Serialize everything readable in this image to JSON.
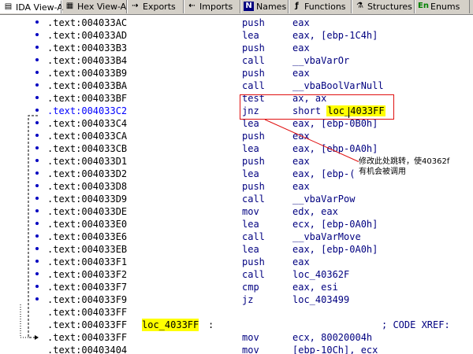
{
  "tabs": [
    {
      "label": "IDA View-A",
      "icon": "ida-view-icon",
      "glyph": "▤",
      "active": true
    },
    {
      "label": "Hex View-A",
      "icon": "hex-view-icon",
      "glyph": "▦",
      "active": false
    },
    {
      "label": "Exports",
      "icon": "exports-icon",
      "glyph": "⇢",
      "active": false
    },
    {
      "label": "Imports",
      "icon": "imports-icon",
      "glyph": "⇠",
      "active": false
    },
    {
      "label": "Names",
      "icon": "names-icon",
      "glyph": "N",
      "active": false
    },
    {
      "label": "Functions",
      "icon": "functions-icon",
      "glyph": "ƒ",
      "active": false
    },
    {
      "label": "Structures",
      "icon": "structures-icon",
      "glyph": "⚗",
      "active": false
    },
    {
      "label": "Enums",
      "icon": "enums-icon",
      "glyph": "En",
      "active": false
    }
  ],
  "rows": [
    {
      "addr": ".text:004033AC",
      "mnem": "push",
      "ops": "eax"
    },
    {
      "addr": ".text:004033AD",
      "mnem": "lea",
      "ops": "eax, [ebp-1C4h]"
    },
    {
      "addr": ".text:004033B3",
      "mnem": "push",
      "ops": "eax"
    },
    {
      "addr": ".text:004033B4",
      "mnem": "call",
      "ops": "__vbaVarOr"
    },
    {
      "addr": ".text:004033B9",
      "mnem": "push",
      "ops": "eax"
    },
    {
      "addr": ".text:004033BA",
      "mnem": "call",
      "ops": "__vbaBoolVarNull"
    },
    {
      "addr": ".text:004033BF",
      "mnem": "test",
      "ops": "ax, ax"
    },
    {
      "addr": ".text:004033C2",
      "mnem": "jnz",
      "ops_prefix": "short ",
      "ops_hl": "loc_4033FF",
      "addr_hl": true
    },
    {
      "addr": ".text:004033C4",
      "mnem": "lea",
      "ops": "eax, [ebp-0B0h]"
    },
    {
      "addr": ".text:004033CA",
      "mnem": "push",
      "ops": "eax"
    },
    {
      "addr": ".text:004033CB",
      "mnem": "lea",
      "ops": "eax, [ebp-0A0h]"
    },
    {
      "addr": ".text:004033D1",
      "mnem": "push",
      "ops": "eax"
    },
    {
      "addr": ".text:004033D2",
      "mnem": "lea",
      "ops": "eax, [ebp-("
    },
    {
      "addr": ".text:004033D8",
      "mnem": "push",
      "ops": "eax"
    },
    {
      "addr": ".text:004033D9",
      "mnem": "call",
      "ops": "__vbaVarPow"
    },
    {
      "addr": ".text:004033DE",
      "mnem": "mov",
      "ops": "edx, eax"
    },
    {
      "addr": ".text:004033E0",
      "mnem": "lea",
      "ops": "ecx, [ebp-0A0h]"
    },
    {
      "addr": ".text:004033E6",
      "mnem": "call",
      "ops": "__vbaVarMove"
    },
    {
      "addr": ".text:004033EB",
      "mnem": "lea",
      "ops": "eax, [ebp-0A0h]"
    },
    {
      "addr": ".text:004033F1",
      "mnem": "push",
      "ops": "eax"
    },
    {
      "addr": ".text:004033F2",
      "mnem": "call",
      "ops": "loc_40362F"
    },
    {
      "addr": ".text:004033F7",
      "mnem": "cmp",
      "ops": "eax, esi"
    },
    {
      "addr": ".text:004033F9",
      "mnem": "jz",
      "ops": "loc_403499"
    },
    {
      "addr": ".text:004033FF",
      "mnem": "",
      "ops": ""
    },
    {
      "addr": ".text:004033FF",
      "label": "loc_4033FF",
      "label_suffix": ":",
      "xref": "; CODE XREF:"
    },
    {
      "addr": ".text:004033FF",
      "mnem": "mov",
      "ops": "ecx, 80020004h"
    },
    {
      "addr": ".text:00403404",
      "mnem": "mov",
      "ops": "[ebp-10Ch], ecx"
    }
  ],
  "annotation": {
    "line1": "修改此处跳转，使40362f",
    "line2": "有机会被调用"
  },
  "colors": {
    "tab_bg": "#d4d0c8",
    "highlight": "#ffff00",
    "annotation_red": "#e01010",
    "instruction_blue": "#000080"
  }
}
